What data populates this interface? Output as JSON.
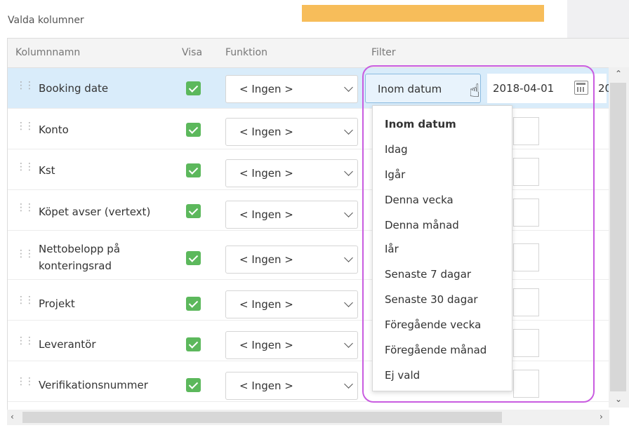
{
  "section_title": "Valda kolumner",
  "columns": {
    "name": "Kolumnnamn",
    "show": "Visa",
    "function": "Funktion",
    "filter": "Filter"
  },
  "rows": [
    {
      "name": "Booking date",
      "function": "< Ingen >",
      "shown": true
    },
    {
      "name": "Konto",
      "function": "< Ingen >",
      "shown": true
    },
    {
      "name": "Kst",
      "function": "< Ingen >",
      "shown": true
    },
    {
      "name": "Köpet avser (vertext)",
      "function": "< Ingen >",
      "shown": true
    },
    {
      "name_line1": "Nettobelopp på",
      "name_line2": "konteringsrad",
      "function": "< Ingen >",
      "shown": true
    },
    {
      "name": "Projekt",
      "function": "< Ingen >",
      "shown": true
    },
    {
      "name": "Leverantör",
      "function": "< Ingen >",
      "shown": true
    },
    {
      "name": "Verifikationsnummer",
      "function": "< Ingen >",
      "shown": true
    }
  ],
  "filter": {
    "selected": "Inom datum",
    "date_from": "2018-04-01",
    "date_to_partial": "20"
  },
  "dropdown_options": [
    "Inom datum",
    "Idag",
    "Igår",
    "Denna vecka",
    "Denna månad",
    "Iår",
    "Senaste 7 dagar",
    "Senaste 30 dagar",
    "Föregående vecka",
    "Föregående månad",
    "Ej vald"
  ],
  "colors": {
    "selected_row": "#d9ecfa",
    "checkbox": "#5cb85c",
    "highlight": "#c95ce0",
    "orange_bar": "#f7bd5a"
  }
}
